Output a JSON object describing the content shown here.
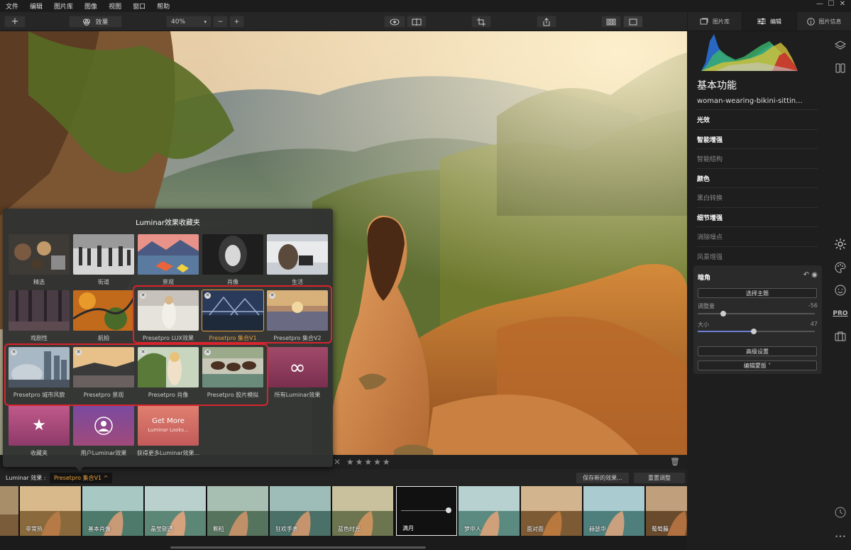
{
  "menu": [
    "文件",
    "编辑",
    "图片库",
    "图像",
    "视图",
    "窗口",
    "帮助"
  ],
  "window_controls": [
    "—",
    "☐",
    "✕"
  ],
  "toolbar": {
    "add": "+",
    "effects": "效果",
    "zoom": "40%",
    "minus": "−",
    "plus": "+"
  },
  "right_tabs": [
    {
      "label": "图片库"
    },
    {
      "label": "编辑"
    },
    {
      "label": "图片信息"
    }
  ],
  "panel": {
    "title": "基本功能",
    "filename": "woman-wearing-bikini-sittin...",
    "sections": [
      {
        "label": "光效",
        "style": "b"
      },
      {
        "label": "智能增强",
        "style": "b"
      },
      {
        "label": "智能结构",
        "style": "d"
      },
      {
        "label": "颜色",
        "style": "b"
      },
      {
        "label": "黑白转换",
        "style": "d"
      },
      {
        "label": "细节增强",
        "style": "b"
      },
      {
        "label": "消除噪点",
        "style": "d"
      },
      {
        "label": "风景增强",
        "style": "d"
      }
    ],
    "vignette": {
      "title": "暗角",
      "select_subject": "选择主题",
      "amount_label": "调整量",
      "amount_value": "-56",
      "amount_pos": 0.22,
      "size_label": "大小",
      "size_value": "47",
      "size_pos": 0.48,
      "advanced": "高级设置",
      "mask": "编辑蒙版 ˅"
    },
    "pro_icon": "PRO"
  },
  "popup": {
    "title": "Luminar效果收藏夹",
    "tiles": [
      {
        "label": "精选"
      },
      {
        "label": "街道"
      },
      {
        "label": "景观"
      },
      {
        "label": "肖像"
      },
      {
        "label": "生活"
      },
      {
        "label": "戏剧性"
      },
      {
        "label": "航拍"
      },
      {
        "label": "Presetpro LUX效果"
      },
      {
        "label": "Presetpro 集合V1"
      },
      {
        "label": "Presetpro 集合V2"
      },
      {
        "label": "Presetpro 城市风貌"
      },
      {
        "label": "Presetpro 景观"
      },
      {
        "label": "Presetpro 肖像"
      },
      {
        "label": "Presetpro 胶片模拟"
      },
      {
        "label": "所有Luminar效果"
      },
      {
        "label": "收藏夹"
      },
      {
        "label": "用户Luminar效果"
      },
      {
        "label": "获得更多Luminar效果..."
      }
    ],
    "get_more": "Get More",
    "get_more_sub": "Luminar Looks...",
    "infinity": "∞",
    "star": "★",
    "x": "✕"
  },
  "rating": {
    "stars": "✕ ★★★★★",
    "trash": "🗑"
  },
  "fxbar": {
    "label": "Luminar 效果 :",
    "selected": "Presetpro 集合V1  ^",
    "save": "保存新的效果...",
    "reset": "重置调整"
  },
  "strip": [
    {
      "label": "非常热"
    },
    {
      "label": "基本肖像"
    },
    {
      "label": "晶莹剔透"
    },
    {
      "label": "颗粒"
    },
    {
      "label": "狂欢手表"
    },
    {
      "label": "蓝色时光"
    },
    {
      "label": "满月"
    },
    {
      "label": "梦中人"
    },
    {
      "label": "面对面"
    },
    {
      "label": "赫瑟华"
    },
    {
      "label": "葡萄藤"
    }
  ],
  "colors": {
    "accent": "#e9a13b",
    "annotation": "#d8242d"
  }
}
